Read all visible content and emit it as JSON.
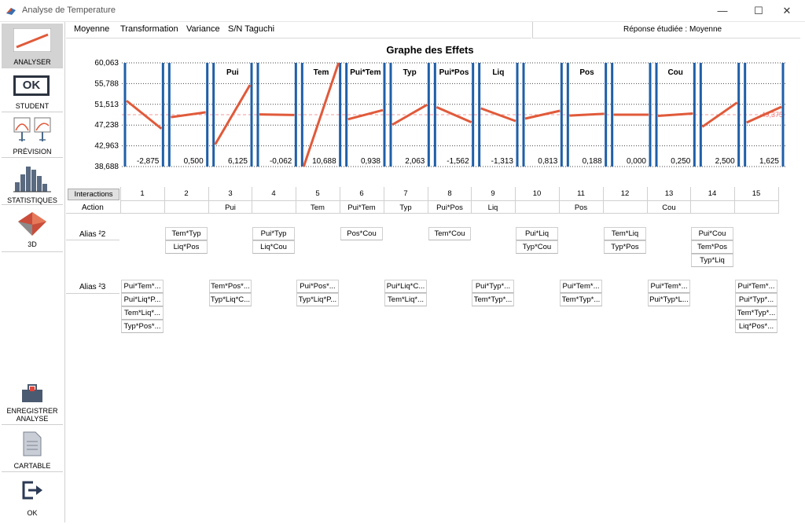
{
  "window": {
    "title": "Analyse de Temperature",
    "minimize": "—",
    "maximize": "☐",
    "close": "✕"
  },
  "sidebar": {
    "analyser": "ANALYSER",
    "student": "STUDENT",
    "student_icon_text": "OK",
    "prevision": "PRÉVISION",
    "statistiques": "STATISTIQUES",
    "three_d": "3D",
    "enregistrer_line1": "ENREGISTRER",
    "enregistrer_line2": "ANALYSE",
    "cartable": "CARTABLE",
    "ok": "OK"
  },
  "menu": {
    "moyenne": "Moyenne",
    "transformation": "Transformation",
    "variance": "Variance",
    "sn_taguchi": "S/N Taguchi"
  },
  "response_label": "Réponse étudiée : Moyenne",
  "chart_data": {
    "type": "line",
    "title": "Graphe des Effets",
    "ylim": [
      38.688,
      60.063
    ],
    "y_ticks": [
      "60,063",
      "55,788",
      "51,513",
      "47,238",
      "42,963",
      "38,688"
    ],
    "mean_line": 49.375,
    "mean_label": "49,375",
    "line_color": "#e05a3a",
    "bar_color": "#1f5fa8",
    "columns": [
      {
        "index": 1,
        "label": "",
        "effect": "-2,875",
        "y_start": 52.25,
        "y_end": 46.5
      },
      {
        "index": 2,
        "label": "",
        "effect": "0,500",
        "y_start": 48.875,
        "y_end": 49.875
      },
      {
        "index": 3,
        "label": "Pui",
        "effect": "6,125",
        "y_start": 43.25,
        "y_end": 55.5
      },
      {
        "index": 4,
        "label": "",
        "effect": "-0,062",
        "y_start": 49.437,
        "y_end": 49.313
      },
      {
        "index": 5,
        "label": "Tem",
        "effect": "10,688",
        "y_start": 38.688,
        "y_end": 60.063
      },
      {
        "index": 6,
        "label": "Pui*Tem",
        "effect": "0,938",
        "y_start": 48.437,
        "y_end": 50.313
      },
      {
        "index": 7,
        "label": "Typ",
        "effect": "2,063",
        "y_start": 47.312,
        "y_end": 51.438
      },
      {
        "index": 8,
        "label": "Pui*Pos",
        "effect": "-1,562",
        "y_start": 50.938,
        "y_end": 47.813
      },
      {
        "index": 9,
        "label": "Liq",
        "effect": "-1,313",
        "y_start": 50.687,
        "y_end": 48.063
      },
      {
        "index": 10,
        "label": "",
        "effect": "0,813",
        "y_start": 48.562,
        "y_end": 50.188
      },
      {
        "index": 11,
        "label": "Pos",
        "effect": "0,188",
        "y_start": 49.187,
        "y_end": 49.563
      },
      {
        "index": 12,
        "label": "",
        "effect": "0,000",
        "y_start": 49.375,
        "y_end": 49.375
      },
      {
        "index": 13,
        "label": "Cou",
        "effect": "0,250",
        "y_start": 49.125,
        "y_end": 49.625
      },
      {
        "index": 14,
        "label": "",
        "effect": "2,500",
        "y_start": 46.875,
        "y_end": 51.875
      },
      {
        "index": 15,
        "label": "",
        "effect": "1,625",
        "y_start": 47.75,
        "y_end": 51.0
      }
    ]
  },
  "table": {
    "interactions_button": "Interactions",
    "action_label": "Action",
    "alias2_label": "Alias ²2",
    "alias3_label": "Alias ²3",
    "columns": [
      "1",
      "2",
      "3",
      "4",
      "5",
      "6",
      "7",
      "8",
      "9",
      "10",
      "11",
      "12",
      "13",
      "14",
      "15"
    ],
    "actions": [
      "",
      "",
      "Pui",
      "",
      "Tem",
      "Pui*Tem",
      "Typ",
      "Pui*Pos",
      "Liq",
      "",
      "Pos",
      "",
      "Cou",
      "",
      ""
    ],
    "alias2": [
      [],
      [
        "Tem*Typ",
        "Liq*Pos"
      ],
      [],
      [
        "Pui*Typ",
        "Liq*Cou"
      ],
      [],
      [
        "Pos*Cou"
      ],
      [],
      [
        "Tem*Cou"
      ],
      [],
      [
        "Pui*Liq",
        "Typ*Cou"
      ],
      [],
      [
        "Tem*Liq",
        "Typ*Pos"
      ],
      [],
      [
        "Pui*Cou",
        "Tem*Pos",
        "Typ*Liq"
      ],
      []
    ],
    "alias3": [
      [
        "Pui*Tem*...",
        "Pui*Liq*P...",
        "Tem*Liq*...",
        "Typ*Pos*..."
      ],
      [],
      [
        "Tem*Pos*...",
        "Typ*Liq*C..."
      ],
      [],
      [
        "Pui*Pos*...",
        "Typ*Liq*P..."
      ],
      [],
      [
        "Pui*Liq*C...",
        "Tem*Liq*..."
      ],
      [],
      [
        "Pui*Typ*...",
        "Tem*Typ*..."
      ],
      [],
      [
        "Pui*Tem*...",
        "Tem*Typ*..."
      ],
      [],
      [
        "Pui*Tem*...",
        "Pui*Typ*L..."
      ],
      [],
      [
        "Pui*Tem*...",
        "Pui*Typ*...",
        "Tem*Typ*...",
        "Liq*Pos*..."
      ]
    ]
  }
}
